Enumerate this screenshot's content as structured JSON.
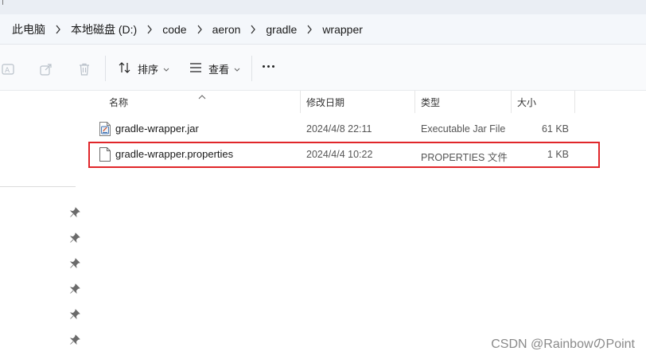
{
  "breadcrumb": {
    "items": [
      "此电脑",
      "本地磁盘 (D:)",
      "code",
      "aeron",
      "gradle",
      "wrapper"
    ]
  },
  "toolbar": {
    "sort_label": "排序",
    "view_label": "查看"
  },
  "columns": {
    "name": "名称",
    "modified": "修改日期",
    "type": "类型",
    "size": "大小"
  },
  "files": [
    {
      "name": "gradle-wrapper.jar",
      "modified": "2024/4/8 22:11",
      "type": "Executable Jar File",
      "size": "61 KB",
      "icon": "jar-file-icon"
    },
    {
      "name": "gradle-wrapper.properties",
      "modified": "2024/4/4 10:22",
      "type": "PROPERTIES 文件",
      "size": "1 KB",
      "icon": "generic-file-icon"
    }
  ],
  "highlight_color": "#e0262a",
  "watermark": "CSDN @RainbowのPoint"
}
